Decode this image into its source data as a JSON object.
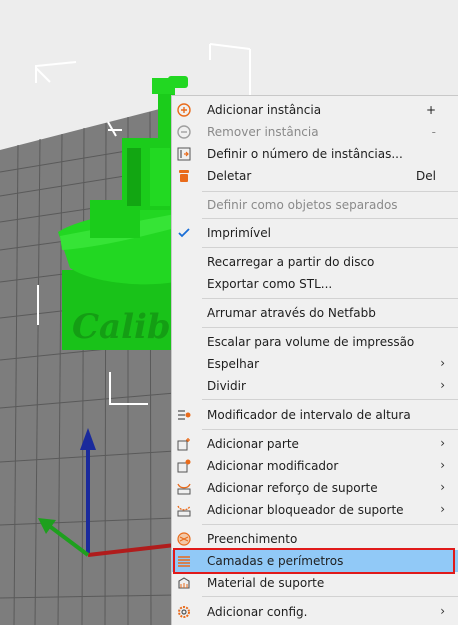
{
  "colors": {
    "model": "#1fd81f",
    "grid_line": "#555555",
    "bed": "#7d7d7d",
    "menu_bg": "#f0f0f0",
    "highlight": "#91c9f7",
    "highlight_border": "#e01a1a",
    "accent": "#e96b1b",
    "axis_z": "#1a2a9c",
    "axis_x": "#b01c1c",
    "axis_y": "#1ea01e"
  },
  "model_text": "Calibr",
  "menu": {
    "items": [
      {
        "key": "add_instance",
        "label": "Adicionar instância",
        "shortcut": "+",
        "icon": "plus-circle-icon",
        "enabled": true
      },
      {
        "key": "remove_instance",
        "label": "Remover instância",
        "shortcut": "-",
        "icon": "minus-circle-icon",
        "enabled": false
      },
      {
        "key": "set_instances",
        "label": "Definir o número de instâncias...",
        "icon": "instances-icon",
        "enabled": true
      },
      {
        "key": "delete",
        "label": "Deletar",
        "shortcut": "Del",
        "icon": "trash-icon",
        "enabled": true
      },
      {
        "key": "separate_objects",
        "label": "Definir como objetos separados",
        "enabled": false
      },
      {
        "key": "printable",
        "label": "Imprimível",
        "icon": "check-icon",
        "enabled": true
      },
      {
        "key": "reload",
        "label": "Recarregar a partir do disco",
        "enabled": true
      },
      {
        "key": "export_stl",
        "label": "Exportar como STL...",
        "enabled": true
      },
      {
        "key": "netfabb",
        "label": "Arrumar através do Netfabb",
        "enabled": true
      },
      {
        "key": "scale_volume",
        "label": "Escalar para volume de impressão",
        "enabled": true
      },
      {
        "key": "mirror",
        "label": "Espelhar",
        "submenu": true,
        "enabled": true
      },
      {
        "key": "split",
        "label": "Dividir",
        "submenu": true,
        "enabled": true
      },
      {
        "key": "height_range",
        "label": "Modificador de intervalo de altura",
        "icon": "height-range-icon",
        "enabled": true
      },
      {
        "key": "add_part",
        "label": "Adicionar parte",
        "icon": "add-part-icon",
        "submenu": true,
        "enabled": true
      },
      {
        "key": "add_modifier",
        "label": "Adicionar modificador",
        "icon": "add-modifier-icon",
        "submenu": true,
        "enabled": true
      },
      {
        "key": "add_support_enforcer",
        "label": "Adicionar reforço de suporte",
        "icon": "support-enforcer-icon",
        "submenu": true,
        "enabled": true
      },
      {
        "key": "add_support_blocker",
        "label": "Adicionar bloqueador de suporte",
        "icon": "support-blocker-icon",
        "submenu": true,
        "enabled": true
      },
      {
        "key": "infill",
        "label": "Preenchimento",
        "icon": "infill-icon",
        "enabled": true
      },
      {
        "key": "layers_perimeters",
        "label": "Camadas e perímetros",
        "icon": "layers-icon",
        "enabled": true,
        "highlighted": true
      },
      {
        "key": "support_material",
        "label": "Material de suporte",
        "icon": "support-material-icon",
        "enabled": true
      },
      {
        "key": "add_config",
        "label": "Adicionar config.",
        "icon": "gear-icon",
        "submenu": true,
        "enabled": true
      }
    ],
    "submenu_arrow": "›"
  }
}
